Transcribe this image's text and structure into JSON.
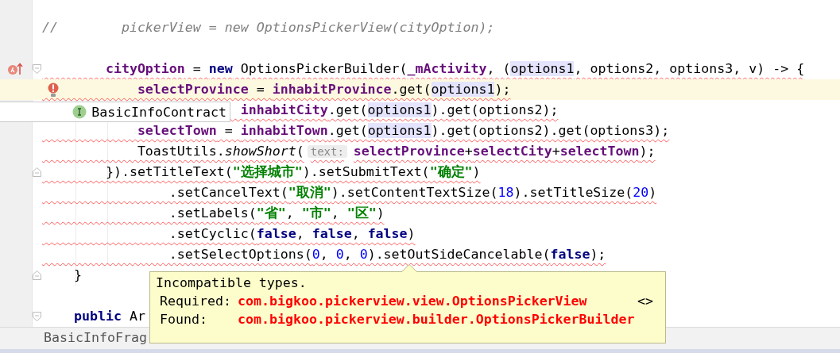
{
  "editor": {
    "lines": [
      {
        "kind": "code",
        "tokens": [
          {
            "kind": "comment",
            "t": "//        pickerView = new OptionsPickerView(cityOption);"
          }
        ]
      },
      {
        "kind": "blank"
      },
      {
        "kind": "code",
        "error": true,
        "gutter_icon": {
          "kind": "override"
        },
        "fold": {
          "kind": "start"
        },
        "tokens": [
          {
            "kind": "field",
            "t": "        cityOption"
          },
          {
            "kind": "plain",
            "t": " = "
          },
          {
            "kind": "kw",
            "t": "new"
          },
          {
            "kind": "plain",
            "t": " OptionsPickerBuilder("
          },
          {
            "kind": "field",
            "t": "_mActivity"
          },
          {
            "kind": "plain",
            "t": ", ("
          },
          {
            "kind": "mark",
            "t": "options1"
          },
          {
            "kind": "plain",
            "t": ", options2, options3, v) -> {"
          }
        ]
      },
      {
        "kind": "code",
        "error": true,
        "current": true,
        "marker": {
          "kind": "bulb"
        },
        "tokens": [
          {
            "kind": "field",
            "t": "            selectProvince"
          },
          {
            "kind": "plain",
            "t": " = "
          },
          {
            "kind": "field",
            "t": "inhabitProvince"
          },
          {
            "kind": "plain",
            "t": ".get("
          },
          {
            "kind": "mark",
            "t": "options1"
          },
          {
            "kind": "plain",
            "t": ");"
          }
        ]
      },
      {
        "kind": "code",
        "error": true,
        "tokens": [
          {
            "kind": "field",
            "t": "                         inhabitCity"
          },
          {
            "kind": "plain",
            "t": ".get("
          },
          {
            "kind": "mark",
            "t": "options1"
          },
          {
            "kind": "plain",
            "t": ").get(options2);"
          }
        ]
      },
      {
        "kind": "code",
        "error": true,
        "tokens": [
          {
            "kind": "field",
            "t": "            selectTown"
          },
          {
            "kind": "plain",
            "t": " = "
          },
          {
            "kind": "field",
            "t": "inhabitTown"
          },
          {
            "kind": "plain",
            "t": ".get("
          },
          {
            "kind": "mark",
            "t": "options1"
          },
          {
            "kind": "plain",
            "t": ").get(options2).get(options3);"
          }
        ]
      },
      {
        "kind": "code",
        "error": true,
        "tokens": [
          {
            "kind": "plain",
            "t": "            ToastUtils."
          },
          {
            "kind": "italic",
            "t": "showShort"
          },
          {
            "kind": "plain",
            "t": "("
          },
          {
            "kind": "hint",
            "t": "text:"
          },
          {
            "kind": "field",
            "t": "selectProvince"
          },
          {
            "kind": "plain",
            "t": "+"
          },
          {
            "kind": "field",
            "t": "selectCity"
          },
          {
            "kind": "plain",
            "t": "+"
          },
          {
            "kind": "field",
            "t": "selectTown"
          },
          {
            "kind": "plain",
            "t": ");"
          }
        ]
      },
      {
        "kind": "code",
        "error": true,
        "fold": {
          "kind": "end"
        },
        "tokens": [
          {
            "kind": "plain",
            "t": "        }).setTitleText("
          },
          {
            "kind": "string",
            "t": "\"选择城市\""
          },
          {
            "kind": "plain",
            "t": ").setSubmitText("
          },
          {
            "kind": "string",
            "t": "\"确定\""
          },
          {
            "kind": "plain",
            "t": ")"
          }
        ]
      },
      {
        "kind": "code",
        "error": true,
        "tokens": [
          {
            "kind": "plain",
            "t": "                .setCancelText("
          },
          {
            "kind": "string",
            "t": "\"取消\""
          },
          {
            "kind": "plain",
            "t": ").setContentTextSize("
          },
          {
            "kind": "number",
            "t": "18"
          },
          {
            "kind": "plain",
            "t": ").setTitleSize("
          },
          {
            "kind": "number",
            "t": "20"
          },
          {
            "kind": "plain",
            "t": ")"
          }
        ]
      },
      {
        "kind": "code",
        "error": true,
        "tokens": [
          {
            "kind": "plain",
            "t": "                .setLabels("
          },
          {
            "kind": "string",
            "t": "\"省\""
          },
          {
            "kind": "plain",
            "t": ", "
          },
          {
            "kind": "string",
            "t": "\"市\""
          },
          {
            "kind": "plain",
            "t": ", "
          },
          {
            "kind": "string",
            "t": "\"区\""
          },
          {
            "kind": "plain",
            "t": ")"
          }
        ]
      },
      {
        "kind": "code",
        "error": true,
        "tokens": [
          {
            "kind": "plain",
            "t": "                .setCyclic("
          },
          {
            "kind": "kw",
            "t": "false"
          },
          {
            "kind": "plain",
            "t": ", "
          },
          {
            "kind": "kw",
            "t": "false"
          },
          {
            "kind": "plain",
            "t": ", "
          },
          {
            "kind": "kw",
            "t": "false"
          },
          {
            "kind": "plain",
            "t": ")"
          }
        ]
      },
      {
        "kind": "code",
        "error": true,
        "tokens": [
          {
            "kind": "plain",
            "t": "                .setSelectOptions("
          },
          {
            "kind": "number",
            "t": "0"
          },
          {
            "kind": "plain",
            "t": ", "
          },
          {
            "kind": "number",
            "t": "0"
          },
          {
            "kind": "plain",
            "t": ", "
          },
          {
            "kind": "number",
            "t": "0"
          },
          {
            "kind": "plain",
            "t": ").setOutSideCancelable("
          },
          {
            "kind": "kw",
            "t": "false"
          },
          {
            "kind": "plain",
            "t": ");"
          }
        ]
      },
      {
        "kind": "code",
        "fold": {
          "kind": "end"
        },
        "tokens": [
          {
            "kind": "plain",
            "t": "    }"
          }
        ]
      },
      {
        "kind": "blank"
      },
      {
        "kind": "code",
        "fold": {
          "kind": "start"
        },
        "tokens": [
          {
            "kind": "kw",
            "t": "    public"
          },
          {
            "kind": "plain",
            "t": " Ar"
          }
        ]
      }
    ]
  },
  "completion_popup": {
    "label": "BasicInfoContract"
  },
  "breadcrumb": "BasicInfoFrag",
  "tooltip": {
    "title": "Incompatible types.",
    "rows": [
      {
        "label": "Required:",
        "value": "com.bigkoo.pickerview.view.OptionsPickerView",
        "extra": "<>"
      },
      {
        "label": "Found:",
        "value": "com.bigkoo.pickerview.builder.OptionsPickerBuilder"
      }
    ]
  }
}
